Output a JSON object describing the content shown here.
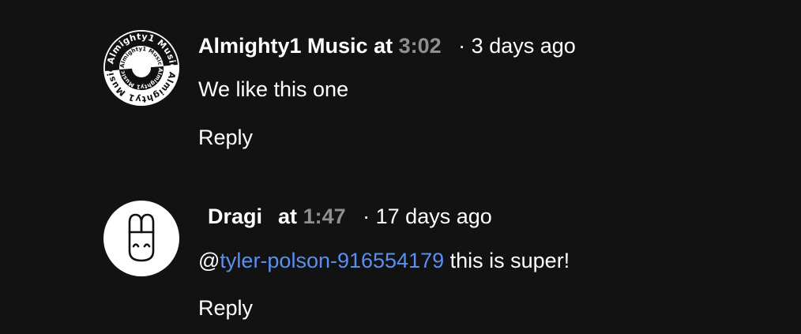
{
  "comments": [
    {
      "author": "Almighty1 Music",
      "at_label": "at",
      "timestamp": "3:02",
      "separator": "·",
      "age": "3 days ago",
      "body": "We like this one",
      "reply_label": "Reply",
      "avatar": {
        "icon": "almighty1-music-logo",
        "outer_text": "Almighty1 Music",
        "inner_text": "Almighty1 Music"
      }
    },
    {
      "author": "Dragi",
      "at_label": "at",
      "timestamp": "1:47",
      "separator": "·",
      "age": "17 days ago",
      "mention_prefix": "@",
      "mention": "tyler-polson-916554179",
      "body": " this is super!",
      "reply_label": "Reply",
      "avatar": {
        "icon": "bunny-face-icon"
      }
    }
  ],
  "colors": {
    "background": "#121212",
    "text": "#ffffff",
    "timestamp": "#8f8f8f",
    "mention": "#5a8ff0"
  }
}
